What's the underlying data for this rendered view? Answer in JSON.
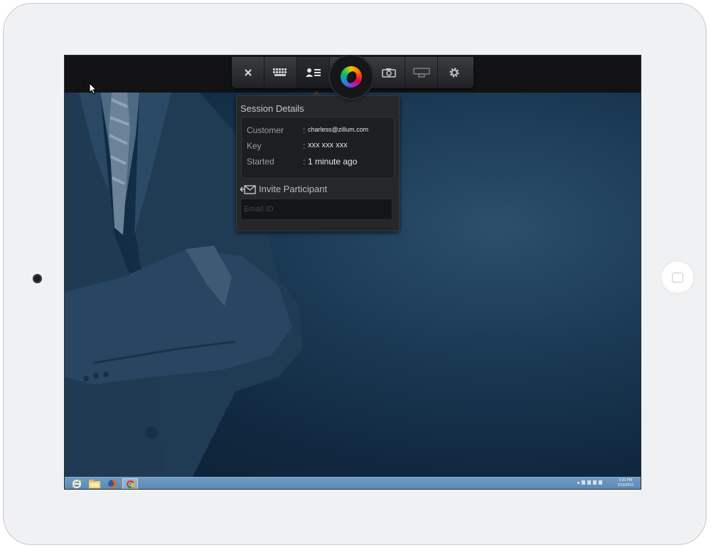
{
  "toolbar": {
    "buttons": [
      "close-icon",
      "keyboard-icon",
      "participants-icon",
      "app-logo-icon",
      "camera-icon",
      "screen-icon",
      "settings-icon"
    ],
    "active": "participants-icon"
  },
  "session": {
    "title": "Session Details",
    "rows": [
      {
        "label": "Customer",
        "value": "charless@zillum.com"
      },
      {
        "label": "Key",
        "value": "xxx xxx xxx"
      },
      {
        "label": "Started",
        "value": "1 minute ago"
      }
    ],
    "colon": ":",
    "invite_label": "Invite Participant",
    "email_placeholder": "Email ID"
  },
  "taskbar": {
    "apps": [
      "internet-explorer-icon",
      "file-explorer-icon",
      "firefox-icon",
      "chrome-icon"
    ],
    "active_app": "chrome-icon",
    "clock_time": "6:23 PM",
    "clock_date": "5/19/2015"
  },
  "colors": {
    "desktop": "#1b3a55",
    "taskbar": "#6f9cc4",
    "popover": "#262729"
  }
}
